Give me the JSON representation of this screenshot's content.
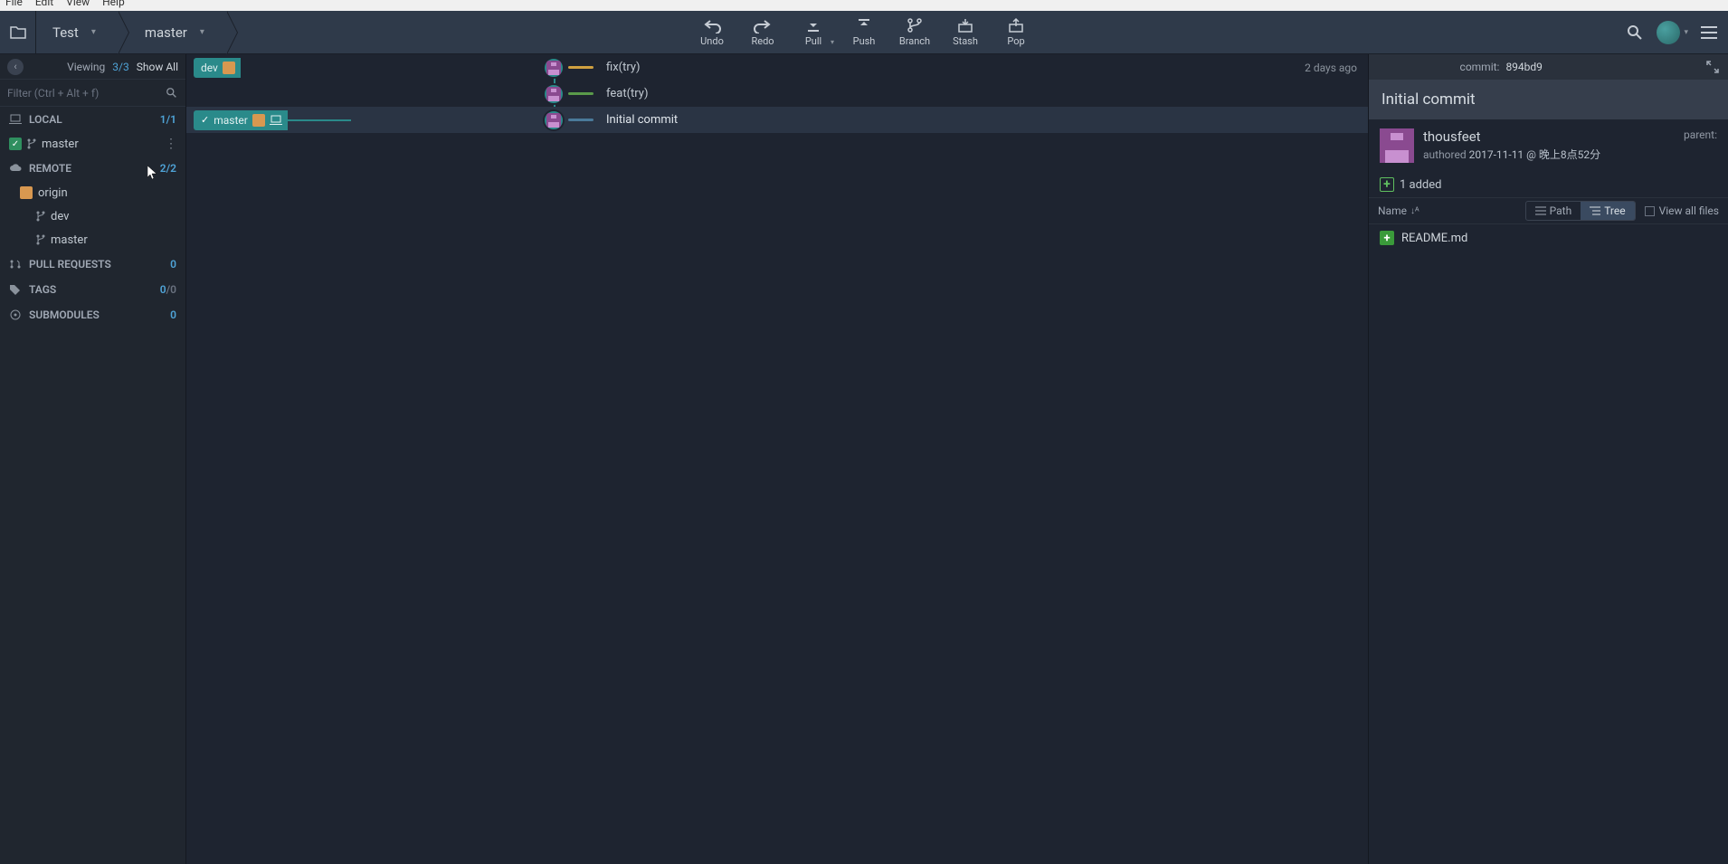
{
  "menubar": [
    "File",
    "Edit",
    "View",
    "Help"
  ],
  "breadcrumb": {
    "repo": "Test",
    "branch": "master"
  },
  "toolbar": {
    "undo": "Undo",
    "redo": "Redo",
    "pull": "Pull",
    "push": "Push",
    "branch": "Branch",
    "stash": "Stash",
    "pop": "Pop"
  },
  "sidebar": {
    "viewing_label": "Viewing",
    "viewing_count": "3/3",
    "showall": "Show All",
    "filter_placeholder": "Filter (Ctrl + Alt + f)",
    "sections": {
      "local": {
        "label": "LOCAL",
        "count": "1/1",
        "items": [
          "master"
        ]
      },
      "remote": {
        "label": "REMOTE",
        "count": "2/2",
        "origin": "origin",
        "items": [
          "dev",
          "master"
        ]
      },
      "pull_requests": {
        "label": "PULL REQUESTS",
        "count": "0"
      },
      "tags": {
        "label": "TAGS",
        "count": "0/0"
      },
      "submodules": {
        "label": "SUBMODULES",
        "count": "0"
      }
    }
  },
  "graph": {
    "rows": [
      {
        "tag": "dev",
        "has_remote_badge": true,
        "msg": "fix(try)",
        "time": "2 days ago",
        "selected": false
      },
      {
        "msg": "feat(try)",
        "selected": false
      },
      {
        "tag": "master",
        "checked": true,
        "has_remote_badge": true,
        "has_laptop": true,
        "msg": "Initial commit",
        "selected": true
      }
    ]
  },
  "right": {
    "commit_label": "commit:",
    "commit_hash": "894bd9",
    "title": "Initial commit",
    "author": "thousfeet",
    "authored_label": "authored",
    "date": "2017-11-11 @ 晚上8点52分",
    "parent_label": "parent:",
    "changes_added": "1 added",
    "name_col": "Name",
    "seg_path": "Path",
    "seg_tree": "Tree",
    "view_all": "View all files",
    "files": [
      "README.md"
    ]
  }
}
